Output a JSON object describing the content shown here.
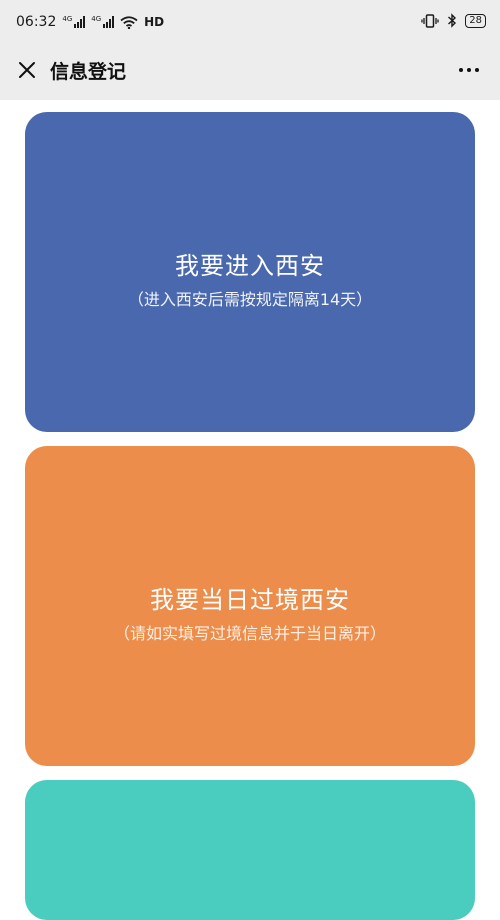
{
  "status_bar": {
    "time": "06:32",
    "signal1_tag": "4G",
    "signal2_tag": "4G",
    "network": "HD",
    "battery": "28"
  },
  "nav": {
    "title": "信息登记",
    "close_icon": "close-icon",
    "more_icon": "more-icon"
  },
  "cards": [
    {
      "title": "我要进入西安",
      "subtitle": "（进入西安后需按规定隔离14天）",
      "color": "#4a68ad"
    },
    {
      "title": "我要当日过境西安",
      "subtitle": "（请如实填写过境信息并于当日离开）",
      "color": "#ed8d4b"
    },
    {
      "color": "#4acdbe"
    }
  ],
  "colors": {
    "top_background": "#ededed",
    "page_background": "#ffffff"
  }
}
